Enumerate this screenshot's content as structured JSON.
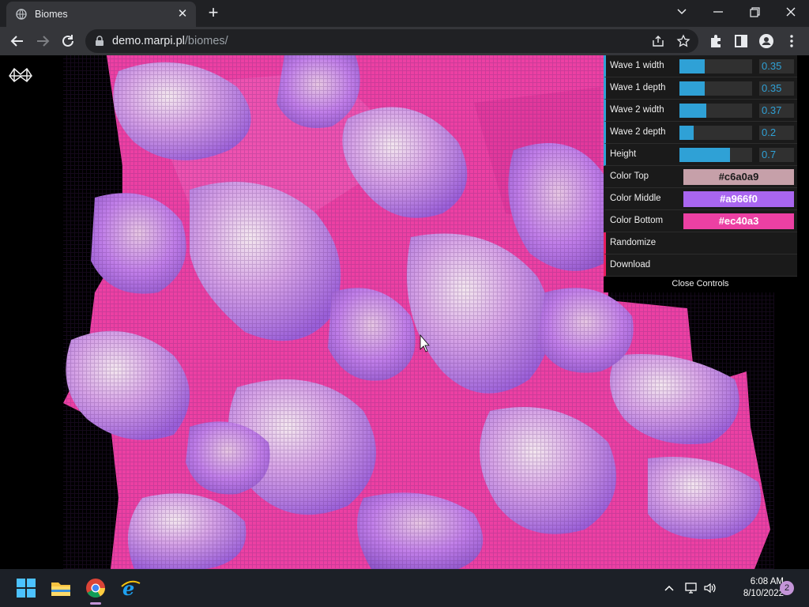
{
  "browser": {
    "tab_title": "Biomes",
    "tab_close": "✕",
    "new_tab": "+",
    "url_host": "demo.marpi.pl",
    "url_path": "/biomes/"
  },
  "controls": {
    "sliders": [
      {
        "label": "Wave 1 width",
        "value": "0.35",
        "fraction": 0.35
      },
      {
        "label": "Wave 1 depth",
        "value": "0.35",
        "fraction": 0.35
      },
      {
        "label": "Wave 2 width",
        "value": "0.37",
        "fraction": 0.37
      },
      {
        "label": "Wave 2 depth",
        "value": "0.2",
        "fraction": 0.2
      },
      {
        "label": "Height",
        "value": "0.7",
        "fraction": 0.7
      }
    ],
    "colors": [
      {
        "label": "Color Top",
        "value": "#c6a0a9",
        "text_color": "#1a1a1a"
      },
      {
        "label": "Color Middle",
        "value": "#a966f0",
        "text_color": "#ffffff"
      },
      {
        "label": "Color Bottom",
        "value": "#ec40a3",
        "text_color": "#ffffff"
      }
    ],
    "randomize_label": "Randomize",
    "download_label": "Download",
    "close_label": "Close Controls"
  },
  "taskbar": {
    "time": "6:08 AM",
    "date": "8/10/2022",
    "notification_count": "2"
  },
  "colors": {
    "accent_slider": "#2fa1d6",
    "scene_pink": "#ec40a3",
    "scene_violet": "#a966f0",
    "scene_top": "#c6a0a9"
  }
}
